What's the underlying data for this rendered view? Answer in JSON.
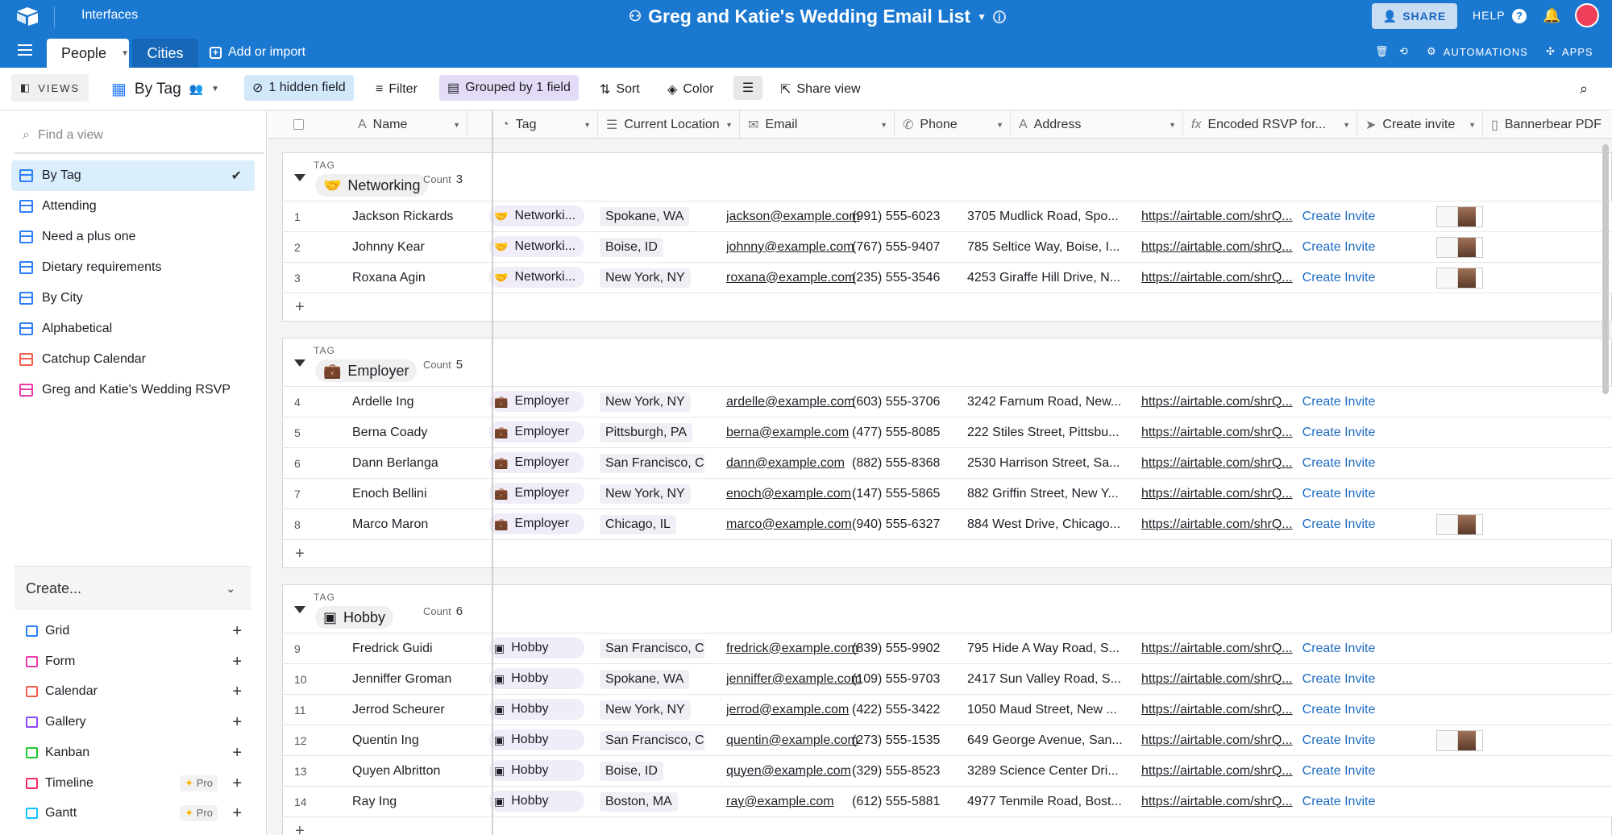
{
  "app": {
    "interfaces_label": "Interfaces",
    "base_title": "Greg and Katie's Wedding Email List",
    "share_label": "SHARE",
    "help_label": "HELP",
    "help_q": "?",
    "tables": [
      {
        "label": "People"
      },
      {
        "label": "Cities"
      }
    ],
    "add_import_label": "Add or import",
    "automations_label": "AUTOMATIONS",
    "apps_label": "APPS",
    "colors": {
      "topbar": "#1b78d0",
      "accent": "#2d7ff9"
    }
  },
  "toolbar": {
    "views_label": "VIEWS",
    "current_view": "By Tag",
    "hidden_fields": "1 hidden field",
    "filter": "Filter",
    "grouped": "Grouped by 1 field",
    "sort": "Sort",
    "color": "Color",
    "share_view": "Share view"
  },
  "sidebar": {
    "find_placeholder": "Find a view",
    "views": [
      {
        "label": "By Tag",
        "icon": "grid-icon"
      },
      {
        "label": "Attending",
        "icon": "grid-icon"
      },
      {
        "label": "Need a plus one",
        "icon": "grid-icon"
      },
      {
        "label": "Dietary requirements",
        "icon": "grid-icon"
      },
      {
        "label": "By City",
        "icon": "grid-icon"
      },
      {
        "label": "Alphabetical",
        "icon": "grid-icon"
      },
      {
        "label": "Catchup Calendar",
        "icon": "calendar-icon"
      },
      {
        "label": "Greg and Katie's Wedding RSVP",
        "icon": "form-icon"
      }
    ],
    "create_label": "Create...",
    "create_items": [
      {
        "label": "Grid",
        "pro": ""
      },
      {
        "label": "Form",
        "pro": ""
      },
      {
        "label": "Calendar",
        "pro": ""
      },
      {
        "label": "Gallery",
        "pro": ""
      },
      {
        "label": "Kanban",
        "pro": ""
      },
      {
        "label": "Timeline",
        "pro": "Pro"
      },
      {
        "label": "Gantt",
        "pro": "Pro"
      }
    ]
  },
  "columns": [
    "Name",
    "Tag",
    "Current Location",
    "Email",
    "Phone",
    "Address",
    "Encoded RSVP for...",
    "Create invite",
    "Bannerbear PDF"
  ],
  "group_label": "TAG",
  "count_label": "Count",
  "invite_label": "Create Invite",
  "groups": [
    {
      "name": "Networking",
      "emoji": "🤝",
      "count": "3",
      "rows": [
        {
          "n": "1",
          "name": "Jackson Rickards",
          "tag": "Networki...",
          "loc": "Spokane, WA",
          "email": "jackson@example.com",
          "phone": "(991) 555-6023",
          "addr": "3705 Mudlick Road, Spo...",
          "url": "https://airtable.com/shrQ...",
          "pdf": true
        },
        {
          "n": "2",
          "name": "Johnny Kear",
          "tag": "Networki...",
          "loc": "Boise, ID",
          "email": "johnny@example.com",
          "phone": "(767) 555-9407",
          "addr": "785 Seltice Way, Boise, I...",
          "url": "https://airtable.com/shrQ...",
          "pdf": true
        },
        {
          "n": "3",
          "name": "Roxana Agin",
          "tag": "Networki...",
          "loc": "New York, NY",
          "email": "roxana@example.com",
          "phone": "(235) 555-3546",
          "addr": "4253 Giraffe Hill Drive, N...",
          "url": "https://airtable.com/shrQ...",
          "pdf": true
        }
      ]
    },
    {
      "name": "Employer",
      "emoji": "💼",
      "count": "5",
      "rows": [
        {
          "n": "4",
          "name": "Ardelle Ing",
          "tag": "Employer",
          "loc": "New York, NY",
          "email": "ardelle@example.com",
          "phone": "(603) 555-3706",
          "addr": "3242 Farnum Road, New...",
          "url": "https://airtable.com/shrQ...",
          "pdf": false
        },
        {
          "n": "5",
          "name": "Berna Coady",
          "tag": "Employer",
          "loc": "Pittsburgh, PA",
          "email": "berna@example.com",
          "phone": "(477) 555-8085",
          "addr": "222 Stiles Street, Pittsbu...",
          "url": "https://airtable.com/shrQ...",
          "pdf": false
        },
        {
          "n": "6",
          "name": "Dann Berlanga",
          "tag": "Employer",
          "loc": "San Francisco, CA",
          "email": "dann@example.com",
          "phone": "(882) 555-8368",
          "addr": "2530 Harrison Street, Sa...",
          "url": "https://airtable.com/shrQ...",
          "pdf": false
        },
        {
          "n": "7",
          "name": "Enoch Bellini",
          "tag": "Employer",
          "loc": "New York, NY",
          "email": "enoch@example.com",
          "phone": "(147) 555-5865",
          "addr": "882 Griffin Street, New Y...",
          "url": "https://airtable.com/shrQ...",
          "pdf": false
        },
        {
          "n": "8",
          "name": "Marco Maron",
          "tag": "Employer",
          "loc": "Chicago, IL",
          "email": "marco@example.com",
          "phone": "(940) 555-6327",
          "addr": "884 West Drive, Chicago...",
          "url": "https://airtable.com/shrQ...",
          "pdf": true
        }
      ]
    },
    {
      "name": "Hobby",
      "emoji": "▣",
      "count": "6",
      "rows": [
        {
          "n": "9",
          "name": "Fredrick Guidi",
          "tag": "Hobby",
          "loc": "San Francisco, CA",
          "email": "fredrick@example.com",
          "phone": "(839) 555-9902",
          "addr": "795 Hide A Way Road, S...",
          "url": "https://airtable.com/shrQ...",
          "pdf": false
        },
        {
          "n": "10",
          "name": "Jenniffer Groman",
          "tag": "Hobby",
          "loc": "Spokane, WA",
          "email": "jenniffer@example.com",
          "phone": "(109) 555-9703",
          "addr": "2417 Sun Valley Road, S...",
          "url": "https://airtable.com/shrQ...",
          "pdf": false
        },
        {
          "n": "11",
          "name": "Jerrod Scheurer",
          "tag": "Hobby",
          "loc": "New York, NY",
          "email": "jerrod@example.com",
          "phone": "(422) 555-3422",
          "addr": "1050 Maud Street, New ...",
          "url": "https://airtable.com/shrQ...",
          "pdf": false
        },
        {
          "n": "12",
          "name": "Quentin Ing",
          "tag": "Hobby",
          "loc": "San Francisco, CA",
          "email": "quentin@example.com",
          "phone": "(273) 555-1535",
          "addr": "649 George Avenue, San...",
          "url": "https://airtable.com/shrQ...",
          "pdf": true
        },
        {
          "n": "13",
          "name": "Quyen Albritton",
          "tag": "Hobby",
          "loc": "Boise, ID",
          "email": "quyen@example.com",
          "phone": "(329) 555-8523",
          "addr": "3289 Science Center Dri...",
          "url": "https://airtable.com/shrQ...",
          "pdf": false
        },
        {
          "n": "14",
          "name": "Ray Ing",
          "tag": "Hobby",
          "loc": "Boston, MA",
          "email": "ray@example.com",
          "phone": "(612) 555-5881",
          "addr": "4977 Tenmile Road, Bost...",
          "url": "https://airtable.com/shrQ...",
          "pdf": false
        }
      ]
    }
  ]
}
